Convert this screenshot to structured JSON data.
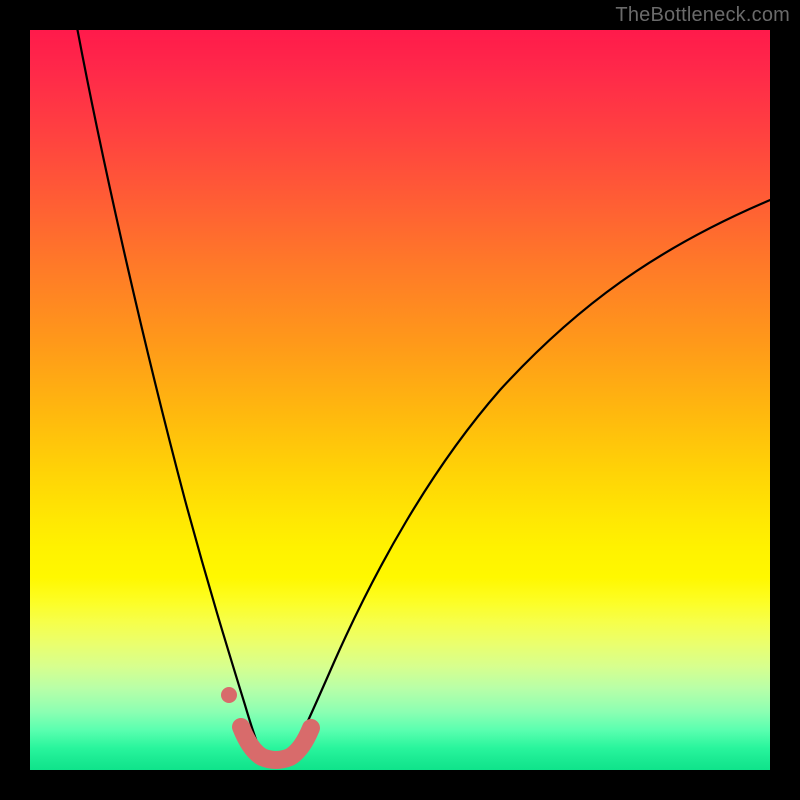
{
  "watermark": "TheBottleneck.com",
  "chart_data": {
    "type": "line",
    "title": "",
    "xlabel": "",
    "ylabel": "",
    "xlim": [
      0,
      100
    ],
    "ylim": [
      0,
      100
    ],
    "grid": false,
    "legend": false,
    "background_gradient": {
      "top": "#ff1a4b",
      "mid": "#fff200",
      "bottom": "#0fe48b"
    },
    "series": [
      {
        "name": "left-branch",
        "color": "#000000",
        "x": [
          6,
          8,
          10,
          12,
          14,
          16,
          18,
          20,
          22,
          24,
          25,
          26,
          27,
          28,
          29,
          30
        ],
        "y": [
          100,
          88,
          77,
          66,
          56,
          47,
          38,
          30,
          22,
          15,
          12,
          9,
          7,
          5,
          3,
          1
        ]
      },
      {
        "name": "right-branch",
        "color": "#000000",
        "x": [
          34,
          36,
          38,
          40,
          43,
          46,
          50,
          55,
          60,
          66,
          72,
          78,
          85,
          92,
          100
        ],
        "y": [
          1,
          4,
          8,
          12,
          18,
          24,
          32,
          40,
          47,
          54,
          60,
          65,
          70,
          74,
          78
        ]
      },
      {
        "name": "highlight-minimum",
        "color": "#d86b6b",
        "x": [
          28,
          29,
          30,
          31,
          32,
          33,
          34,
          35,
          36,
          37
        ],
        "y": [
          4.5,
          2.8,
          1.8,
          1.2,
          1.0,
          1.0,
          1.3,
          1.9,
          3.0,
          4.5
        ]
      }
    ],
    "annotations": [
      {
        "name": "highlight-marker",
        "x": 26.5,
        "y": 9,
        "color": "#d86b6b"
      }
    ]
  }
}
